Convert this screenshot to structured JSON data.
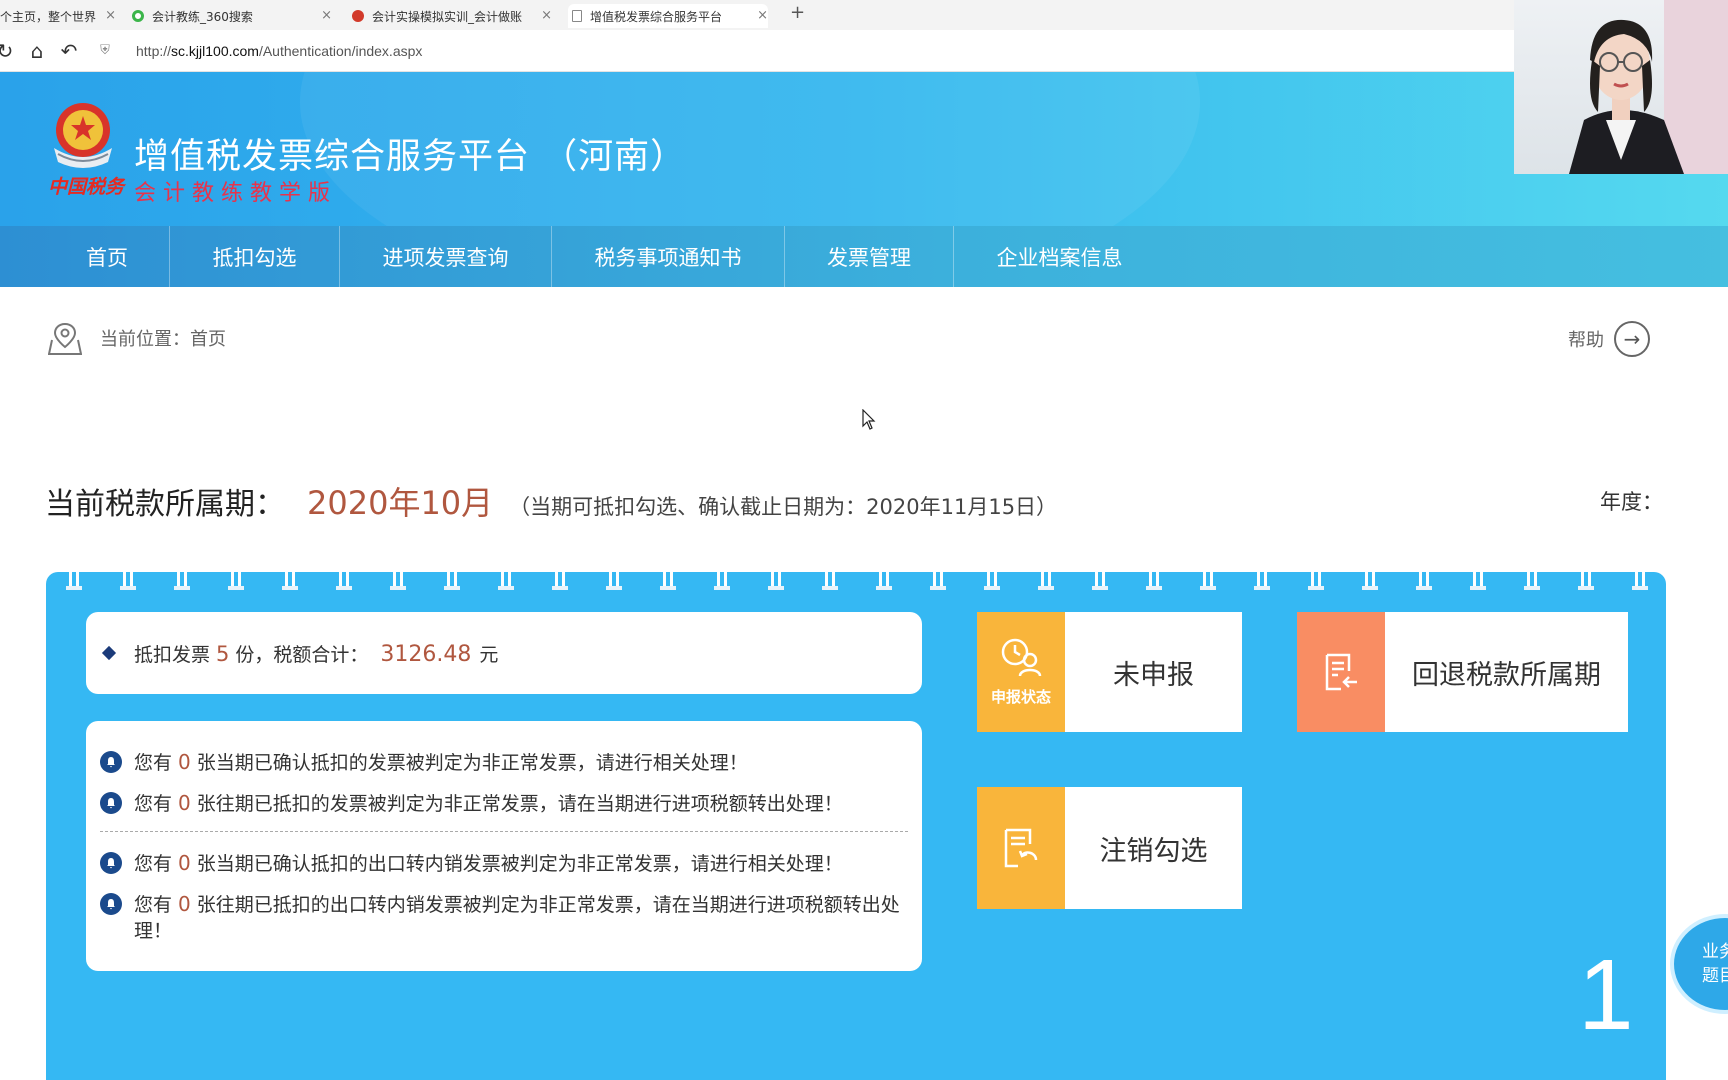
{
  "browser": {
    "tabs": [
      {
        "title": "个主页，整个世界",
        "active": false
      },
      {
        "title": "会计教练_360搜索",
        "active": false
      },
      {
        "title": "会计实操模拟实训_会计做账",
        "active": false
      },
      {
        "title": "增值税发票综合服务平台",
        "active": true
      }
    ],
    "url_prefix": "http://",
    "url_host": "sc.kjjl100.com",
    "url_path": "/Authentication/index.aspx"
  },
  "header": {
    "title": "增值税发票综合服务平台 （河南）",
    "subtitle": "会计教练教学版",
    "logo_text": "中国税务",
    "nav": [
      "首页",
      "抵扣勾选",
      "进项发票查询",
      "税务事项通知书",
      "发票管理",
      "企业档案信息"
    ]
  },
  "breadcrumb": {
    "label": "当前位置：首页",
    "help": "帮助"
  },
  "period": {
    "label": "当前税款所属期：",
    "value": "2020年10月",
    "note": "（当期可抵扣勾选、确认截止日期为：2020年11月15日）",
    "year_label": "年度："
  },
  "summary": {
    "prefix": "抵扣发票",
    "count": "5",
    "middle": "份，税额合计：",
    "amount": "3126.48",
    "unit": "元"
  },
  "notices": [
    {
      "pre": "您有",
      "count": "0",
      "text": "张当期已确认抵扣的发票被判定为非正常发票，请进行相关处理！"
    },
    {
      "pre": "您有",
      "count": "0",
      "text": "张往期已抵扣的发票被判定为非正常发票，请在当期进行进项税额转出处理！"
    },
    {
      "pre": "您有",
      "count": "0",
      "text": "张当期已确认抵扣的出口转内销发票被判定为非正常发票，请进行相关处理！"
    },
    {
      "pre": "您有",
      "count": "0",
      "text": "张往期已抵扣的出口转内销发票被判定为非正常发票，请在当期进行进项税额转出处理！"
    }
  ],
  "tiles": {
    "status": {
      "caption": "申报状态",
      "label": "未申报"
    },
    "rollback": {
      "label": "回退税款所属期"
    },
    "cancel": {
      "label": "注销勾选"
    }
  },
  "board_number": "1",
  "float_button": {
    "line1": "业务",
    "line2": "题目"
  },
  "colors": {
    "banner": "#35b7ee",
    "board": "#35b8f3",
    "accent_orange": "#f9b53b",
    "accent_salmon": "#f98d63",
    "value_red": "#b0573f"
  }
}
